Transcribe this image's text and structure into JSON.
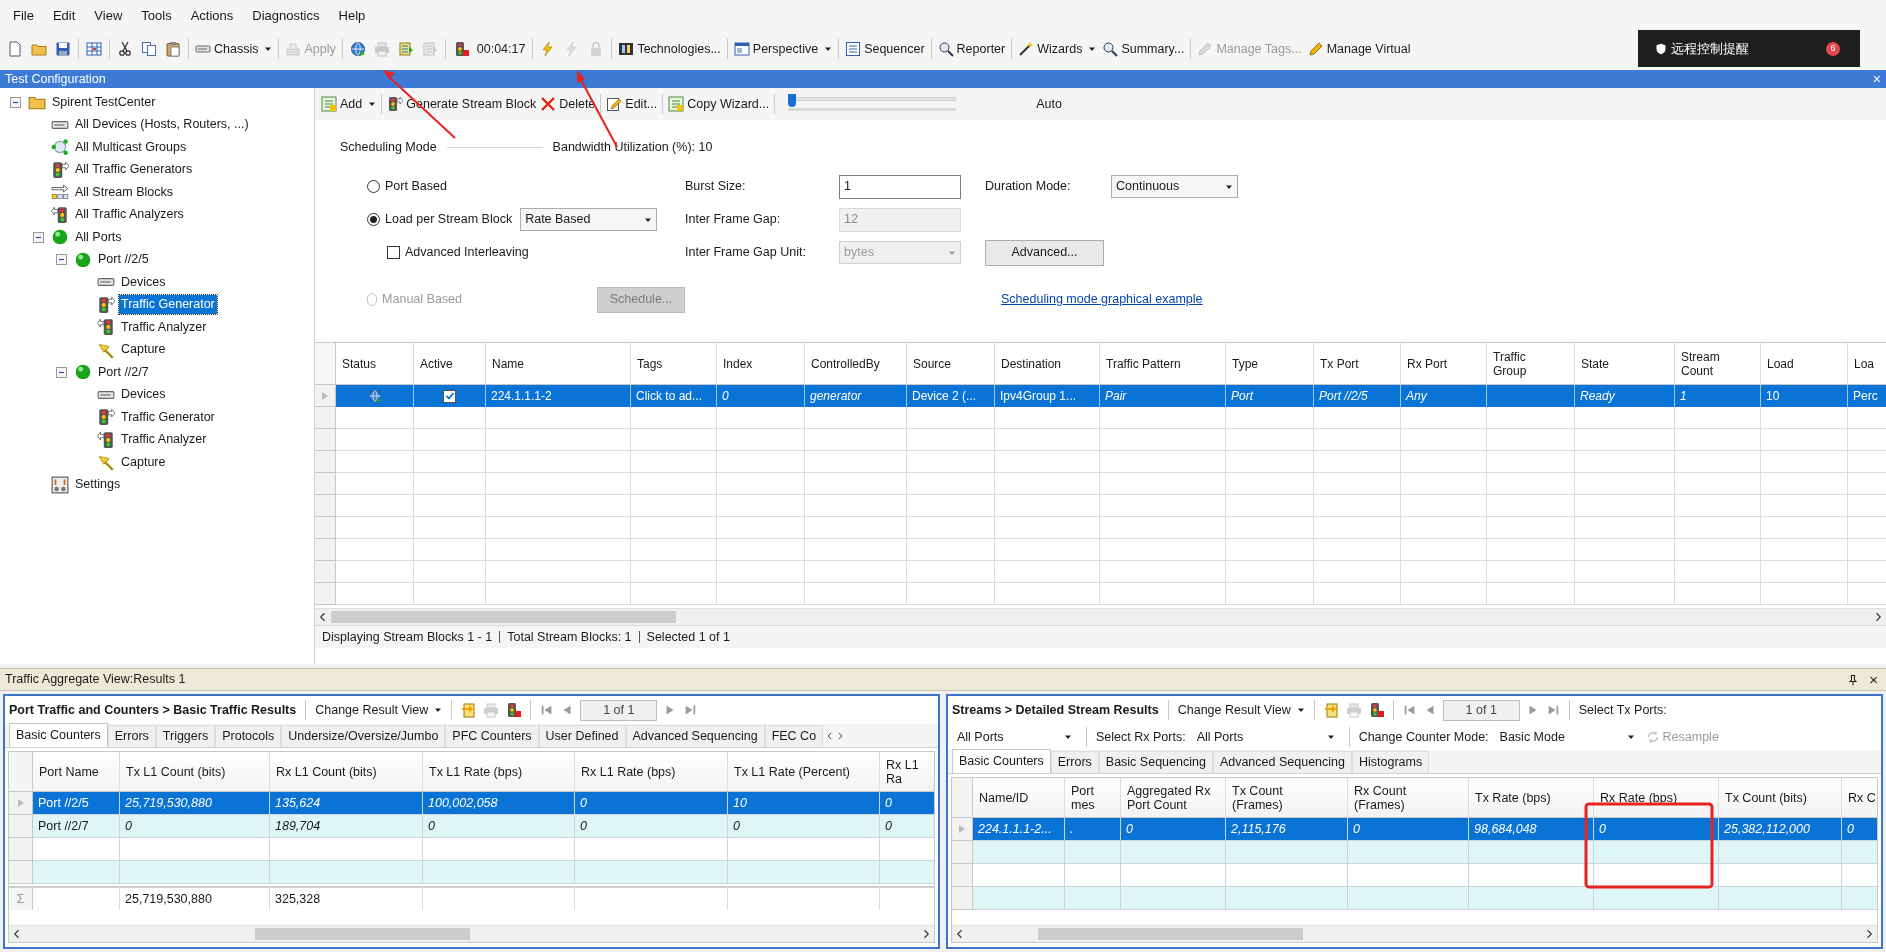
{
  "menu": [
    "File",
    "Edit",
    "View",
    "Tools",
    "Actions",
    "Diagnostics",
    "Help"
  ],
  "toolbar": [
    {
      "kind": "icon",
      "disabled": false
    },
    {
      "kind": "icon",
      "disabled": false
    },
    {
      "kind": "icon",
      "disabled": false
    },
    {
      "kind": "separator"
    },
    {
      "kind": "icon",
      "disabled": false
    },
    {
      "kind": "separator"
    },
    {
      "kind": "icon",
      "disabled": false
    },
    {
      "kind": "icon",
      "disabled": false
    },
    {
      "kind": "icon",
      "disabled": false
    },
    {
      "kind": "separator"
    },
    {
      "kind": "button",
      "label": "Chassis",
      "dropdown": true,
      "disabled": false
    },
    {
      "kind": "separator"
    },
    {
      "kind": "button",
      "label": "Apply",
      "dropdown": false,
      "disabled": true
    },
    {
      "kind": "separator"
    },
    {
      "kind": "icon",
      "disabled": false
    },
    {
      "kind": "icon",
      "disabled": true
    },
    {
      "kind": "icon",
      "disabled": false
    },
    {
      "kind": "icon",
      "disabled": true
    },
    {
      "kind": "separator"
    },
    {
      "kind": "icon",
      "disabled": false
    },
    {
      "kind": "text",
      "label": "00:04:17"
    },
    {
      "kind": "separator"
    },
    {
      "kind": "icon",
      "disabled": false
    },
    {
      "kind": "icon",
      "disabled": true
    },
    {
      "kind": "icon",
      "disabled": true
    },
    {
      "kind": "separator"
    },
    {
      "kind": "button",
      "label": "Technologies...",
      "dropdown": false,
      "disabled": false
    },
    {
      "kind": "separator"
    },
    {
      "kind": "button",
      "label": "Perspective",
      "dropdown": true,
      "disabled": false
    },
    {
      "kind": "separator"
    },
    {
      "kind": "button",
      "label": "Sequencer",
      "dropdown": false,
      "disabled": false
    },
    {
      "kind": "separator"
    },
    {
      "kind": "button",
      "label": "Reporter",
      "dropdown": false,
      "disabled": false
    },
    {
      "kind": "separator"
    },
    {
      "kind": "button",
      "label": "Wizards",
      "dropdown": true,
      "disabled": false
    },
    {
      "kind": "button",
      "label": "Summary...",
      "dropdown": false,
      "disabled": false
    },
    {
      "kind": "separator"
    },
    {
      "kind": "button",
      "label": "Manage Tags...",
      "dropdown": false,
      "disabled": true
    },
    {
      "kind": "button",
      "label": "Manage Virtual",
      "dropdown": false,
      "disabled": false
    }
  ],
  "notification": {
    "text": "远程控制提醒",
    "badge": "6"
  },
  "config_window": {
    "title": "Test Configuration",
    "close": "×"
  },
  "tree": [
    {
      "label": "Spirent TestCenter",
      "kind": "root",
      "expanded": true,
      "selected": false,
      "children": [
        {
          "label": "All Devices (Hosts, Routers, ...)",
          "kind": "device",
          "selected": false
        },
        {
          "label": "All Multicast Groups",
          "kind": "multicast",
          "selected": false
        },
        {
          "label": "All Traffic Generators",
          "kind": "generator",
          "selected": false
        },
        {
          "label": "All Stream Blocks",
          "kind": "streams",
          "selected": false
        },
        {
          "label": "All Traffic Analyzers",
          "kind": "analyzer",
          "selected": false
        },
        {
          "label": "All Ports",
          "kind": "port",
          "expanded": true,
          "selected": false,
          "children": [
            {
              "label": "Port //2/5",
              "kind": "port",
              "expanded": true,
              "selected": false,
              "children": [
                {
                  "label": "Devices",
                  "kind": "device",
                  "selected": false
                },
                {
                  "label": "Traffic Generator",
                  "kind": "generator",
                  "selected": true
                },
                {
                  "label": "Traffic Analyzer",
                  "kind": "analyzer",
                  "selected": false
                },
                {
                  "label": "Capture",
                  "kind": "capture",
                  "selected": false
                }
              ]
            },
            {
              "label": "Port //2/7",
              "kind": "port",
              "expanded": true,
              "selected": false,
              "children": [
                {
                  "label": "Devices",
                  "kind": "device",
                  "selected": false
                },
                {
                  "label": "Traffic Generator",
                  "kind": "generator",
                  "selected": false
                },
                {
                  "label": "Traffic Analyzer",
                  "kind": "analyzer",
                  "selected": false
                },
                {
                  "label": "Capture",
                  "kind": "capture",
                  "selected": false
                }
              ]
            }
          ]
        },
        {
          "label": "Settings",
          "kind": "settings",
          "selected": false
        }
      ]
    }
  ],
  "stream_toolbar": {
    "items": [
      {
        "label": "Add",
        "dropdown": true
      },
      {
        "label": "Generate Stream Block",
        "dropdown": false
      },
      {
        "label": "Delete",
        "dropdown": false
      },
      {
        "label": "Edit...",
        "dropdown": false
      },
      {
        "label": "Copy Wizard...",
        "dropdown": false
      }
    ],
    "slider": {
      "level": 0
    },
    "slider_label": "Auto"
  },
  "scheduling": {
    "group_label": "Scheduling Mode",
    "bandwidth": "Bandwidth Utilization (%): 10",
    "modes": [
      {
        "label": "Port Based",
        "selected": false,
        "disabled": false
      },
      {
        "label": "Load per Stream Block",
        "selected": true,
        "disabled": false
      },
      {
        "label": "Manual Based",
        "selected": false,
        "disabled": true
      }
    ],
    "rate_select": "Rate Based",
    "advanced_interleaving": {
      "label": "Advanced Interleaving",
      "checked": false
    },
    "schedule_button": {
      "label": "Schedule...",
      "disabled": true
    },
    "fields": [
      {
        "label": "Burst Size:",
        "value": "1",
        "kind": "input",
        "disabled": false
      },
      {
        "label": "Inter Frame Gap:",
        "value": "12",
        "kind": "input",
        "disabled": true
      },
      {
        "label": "Inter Frame Gap Unit:",
        "value": "bytes",
        "kind": "select",
        "disabled": true
      }
    ],
    "duration": {
      "label": "Duration Mode:",
      "value": "Continuous"
    },
    "advanced_button": "Advanced...",
    "link": "Scheduling mode graphical example"
  },
  "stream_table": {
    "columns": [
      "Status",
      "Active",
      "Name",
      "Tags",
      "Index",
      "ControlledBy",
      "Source",
      "Destination",
      "Traffic Pattern",
      "Type",
      "Tx Port",
      "Rx Port",
      "Traffic\nGroup",
      "State",
      "Stream\nCount",
      "Load",
      "Loa"
    ],
    "rows": [
      {
        "selected": true,
        "active": true,
        "cells": [
          "",
          "",
          "224.1.1.1-2",
          "Click to ad...",
          "0",
          "generator",
          "Device 2 (...",
          "Ipv4Group 1...",
          "Pair",
          "Port",
          "Port //2/5",
          "Any",
          "",
          "Ready",
          "1",
          "10",
          "Perc"
        ]
      }
    ]
  },
  "status_bar": [
    "Displaying Stream Blocks 1 - 1",
    "Total Stream Blocks: 1",
    "Selected 1 of 1"
  ],
  "results": {
    "title": "Traffic Aggregate View:Results 1",
    "close": "×",
    "panels": [
      {
        "breadcrumb": "Port Traffic and Counters > Basic Traffic Results",
        "view_menu": "Change Result View",
        "page": "1 of 1",
        "tabs": [
          {
            "label": "Basic Counters",
            "selected": true
          },
          {
            "label": "Errors",
            "selected": false
          },
          {
            "label": "Triggers",
            "selected": false
          },
          {
            "label": "Protocols",
            "selected": false
          },
          {
            "label": "Undersize/Oversize/Jumbo",
            "selected": false
          },
          {
            "label": "PFC Counters",
            "selected": false
          },
          {
            "label": "User Defined",
            "selected": false
          },
          {
            "label": "Advanced Sequencing",
            "selected": false
          },
          {
            "label": "FEC Co",
            "selected": false
          }
        ],
        "columns": [
          "Port Name",
          "Tx L1 Count (bits)",
          "Rx L1 Count (bits)",
          "Tx L1 Rate (bps)",
          "Rx L1 Rate (bps)",
          "Tx L1 Rate (Percent)",
          "Rx L1 Ra"
        ],
        "rows": [
          {
            "selected": true,
            "cells": [
              "Port //2/5",
              "25,719,530,880",
              "135,624",
              "100,002,058",
              "0",
              "10",
              "0"
            ]
          },
          {
            "selected": false,
            "cells": [
              "Port //2/7",
              "0",
              "189,704",
              "0",
              "0",
              "0",
              "0"
            ]
          }
        ],
        "totals_label": "Σ",
        "totals": [
          "25,719,530,880",
          "325,328"
        ]
      },
      {
        "breadcrumb": "Streams > Detailed Stream Results",
        "view_menu": "Change Result View",
        "page": "1 of 1",
        "tx_label": "Select Tx Ports:",
        "tx_value": "All Ports",
        "rx_label": "Select Rx Ports:",
        "rx_value": "All Ports",
        "mode_label": "Change Counter Mode:",
        "mode_value": "Basic Mode",
        "resample": {
          "label": "Resample",
          "disabled": true
        },
        "tabs": [
          {
            "label": "Basic Counters",
            "selected": true
          },
          {
            "label": "Errors",
            "selected": false
          },
          {
            "label": "Basic Sequencing",
            "selected": false
          },
          {
            "label": "Advanced Sequencing",
            "selected": false
          },
          {
            "label": "Histograms",
            "selected": false
          }
        ],
        "columns": [
          "Name/ID",
          "Port\nmes",
          "Aggregated Rx\nPort Count",
          "Tx Count\n(Frames)",
          "Rx Count\n(Frames)",
          "Tx Rate (bps)",
          "Rx Rate (bps)",
          "Tx Count (bits)",
          "Rx C"
        ],
        "rows": [
          {
            "selected": true,
            "cells": [
              "224.1.1.1-2...",
              ".",
              "0",
              "2,115,176",
              "0",
              "98,684,048",
              "0",
              "25,382,112,000",
              "0"
            ]
          }
        ]
      }
    ]
  }
}
